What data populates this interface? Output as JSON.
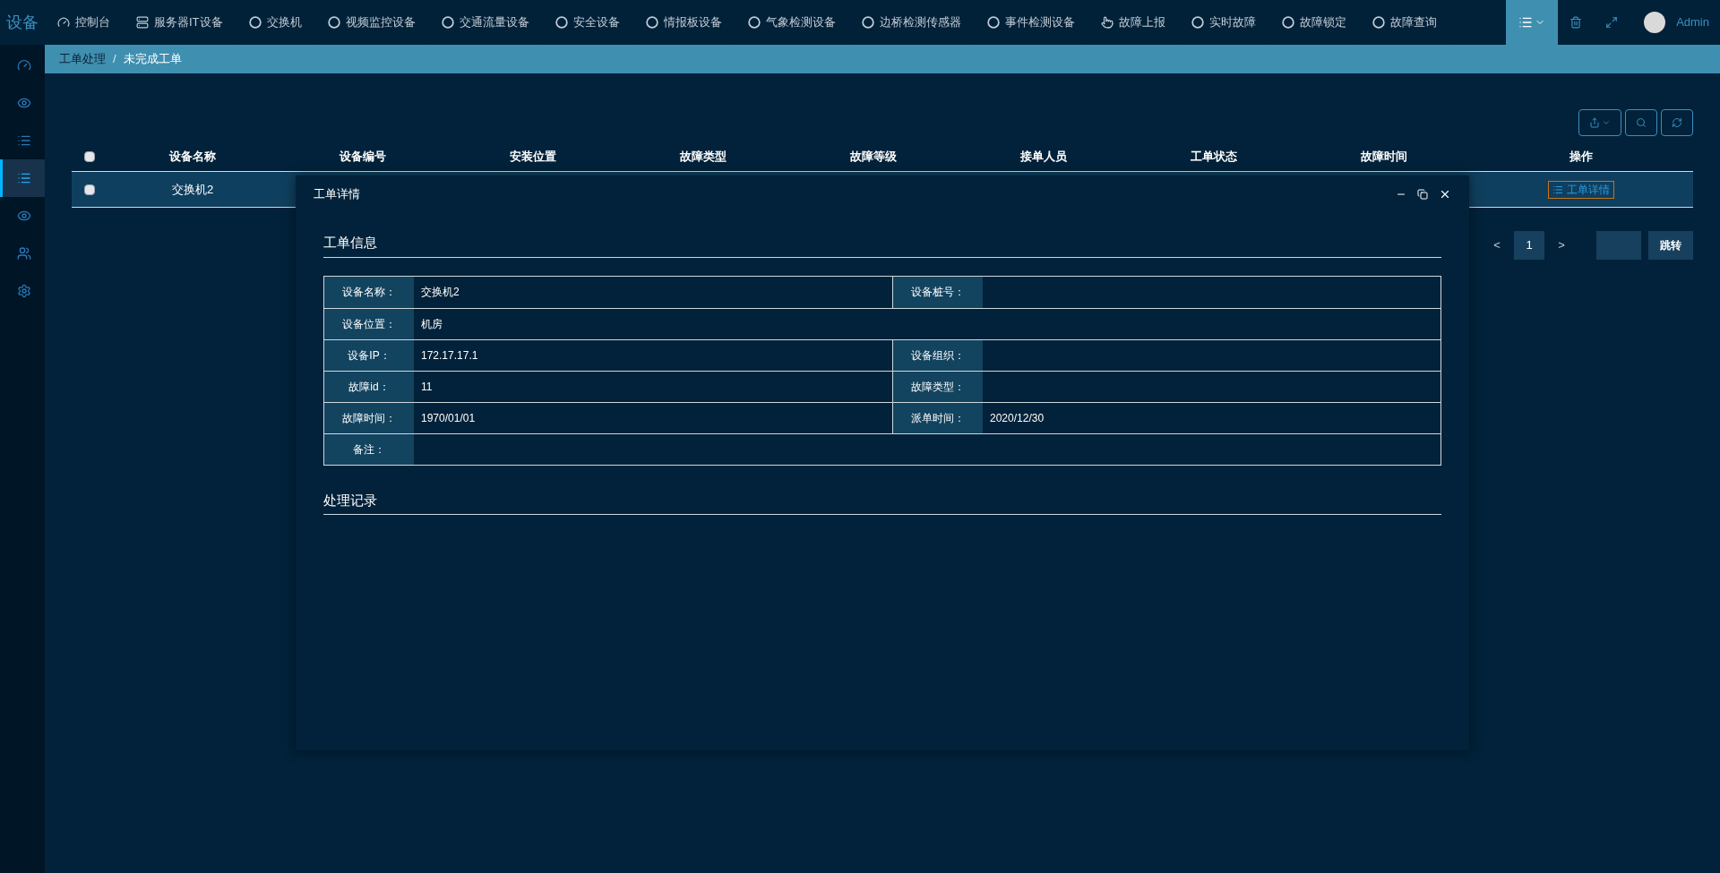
{
  "brand": "设备",
  "nav": [
    "控制台",
    "服务器IT设备",
    "交换机",
    "视频监控设备",
    "交通流量设备",
    "安全设备",
    "情报板设备",
    "气象检测设备",
    "边桥检测传感器",
    "事件检测设备",
    "故障上报",
    "实时故障",
    "故障锁定",
    "故障查询"
  ],
  "user": {
    "name": "Admin"
  },
  "sidebar": [
    {
      "selected": false
    },
    {
      "selected": false
    },
    {
      "selected": false
    },
    {
      "selected": true
    },
    {
      "selected": false
    },
    {
      "selected": false
    },
    {
      "selected": false
    }
  ],
  "breadcrumb": {
    "items": [
      "工单处理",
      "未完成工单"
    ],
    "separator": "/"
  },
  "table": {
    "header_checked": false,
    "columns": [
      "设备名称",
      "设备编号",
      "安装位置",
      "故障类型",
      "故障等级",
      "接单人员",
      "工单状态",
      "故障时间",
      "操作"
    ],
    "rows": [
      {
        "checked": false,
        "name": "交换机2",
        "action": "工单详情"
      }
    ]
  },
  "pagination": {
    "prev": "<",
    "pages": [
      {
        "label": "1",
        "selected": true
      }
    ],
    "next": ">",
    "jump": "跳转"
  },
  "dialog": {
    "title": "工单详情",
    "info_title": "工单信息",
    "records_title": "处理记录",
    "info_rows": [
      [
        {
          "label": "设备名称：",
          "value": "交换机2"
        },
        {
          "label": "设备桩号："
        }
      ],
      [
        {
          "label": "设备位置：",
          "value": "机房"
        }
      ],
      [
        {
          "label": "设备IP：",
          "value": "172.17.17.1"
        },
        {
          "label": "设备组织："
        }
      ],
      [
        {
          "label": "故障id：",
          "value": "11"
        },
        {
          "label": "故障类型："
        }
      ],
      [
        {
          "label": "故障时间：",
          "value": "1970/01/01"
        },
        {
          "label": "派单时间：",
          "value": "2020/12/30"
        }
      ],
      [
        {
          "label": "备注："
        }
      ]
    ]
  }
}
